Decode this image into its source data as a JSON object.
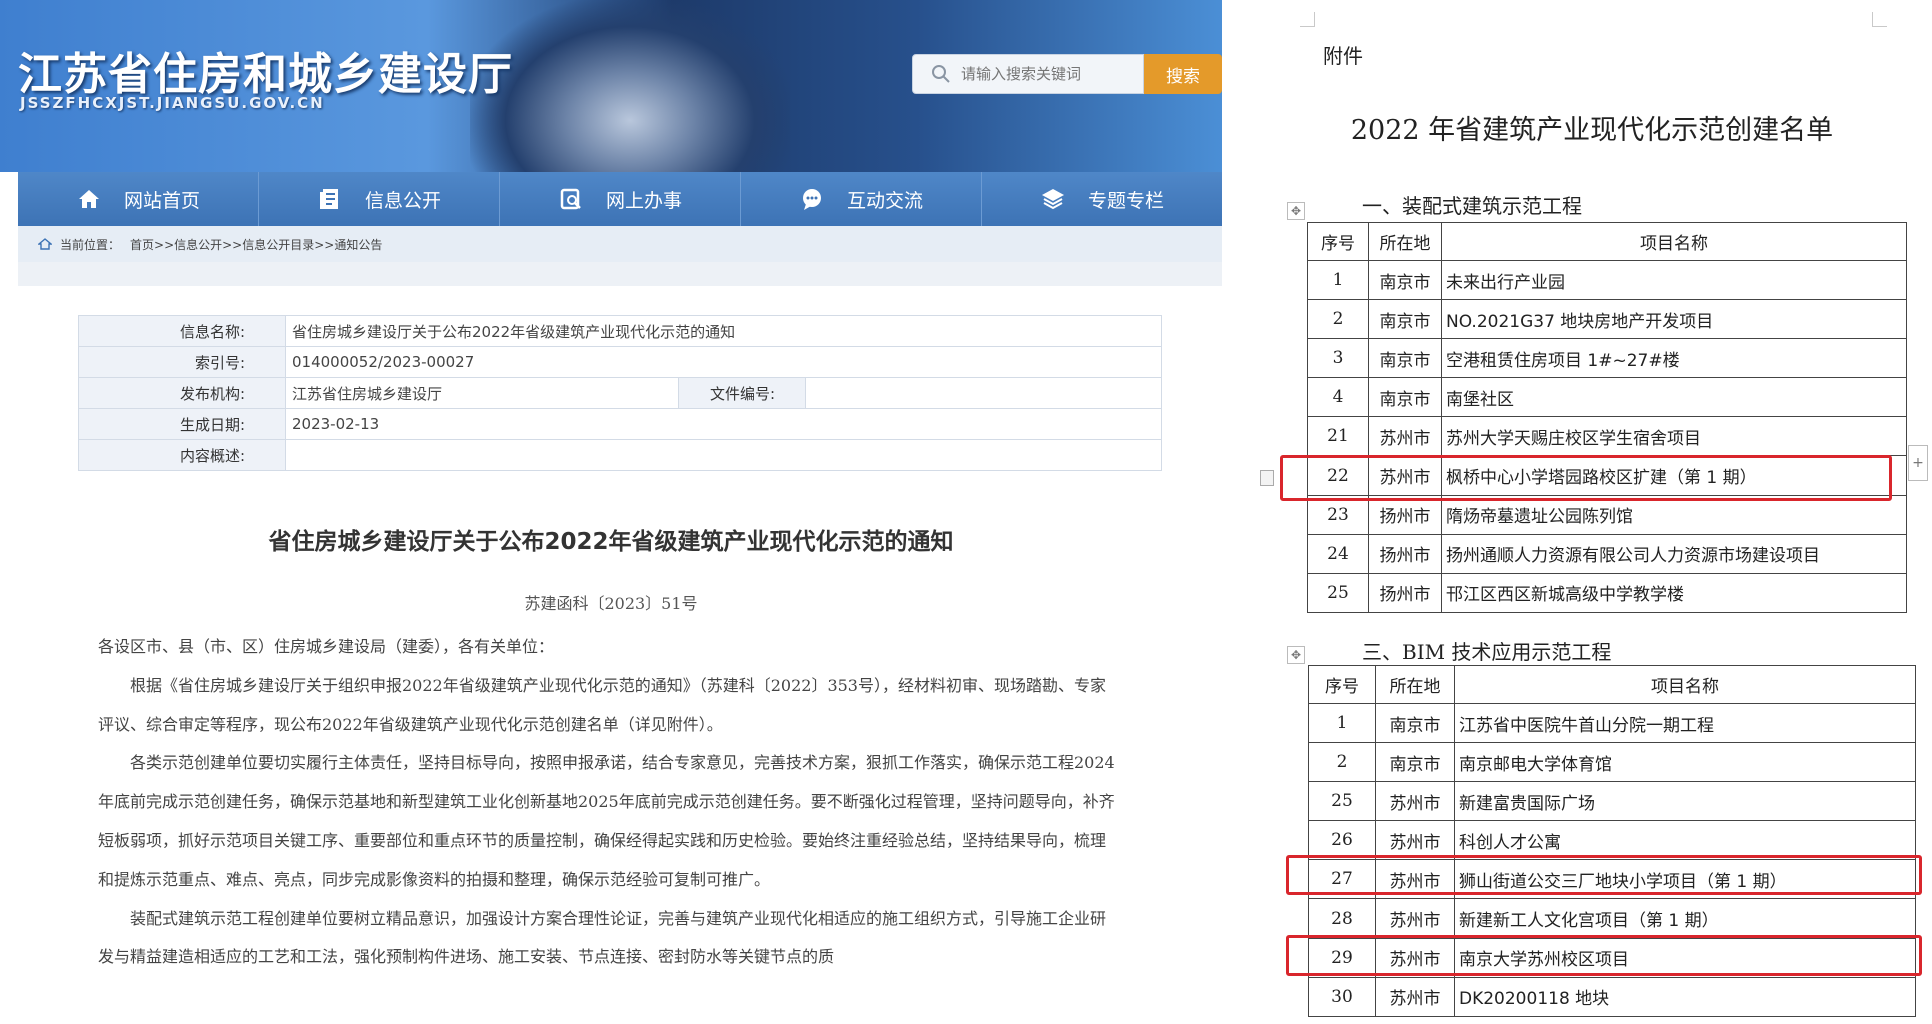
{
  "site": {
    "title": "江苏省住房和城乡建设厅",
    "domain": "JSSZFHCXJST.JIANGSU.GOV.CN",
    "search_placeholder": "请输入搜索关键词",
    "search_button": "搜索"
  },
  "nav": [
    {
      "label": "网站首页",
      "icon": "home-icon"
    },
    {
      "label": "信息公开",
      "icon": "document-icon"
    },
    {
      "label": "网上办事",
      "icon": "service-icon"
    },
    {
      "label": "互动交流",
      "icon": "chat-icon"
    },
    {
      "label": "专题专栏",
      "icon": "layers-icon"
    }
  ],
  "breadcrumb": {
    "label": "当前位置：",
    "path": "首页>>信息公开>>信息公开目录>>通知公告"
  },
  "info": {
    "name_label": "信息名称:",
    "name_value": "省住房城乡建设厅关于公布2022年省级建筑产业现代化示范的通知",
    "index_label": "索引号:",
    "index_value": "014000052/2023-00027",
    "org_label": "发布机构:",
    "org_value": "江苏省住房城乡建设厅",
    "fileno_label": "文件编号:",
    "fileno_value": "",
    "date_label": "生成日期:",
    "date_value": "2023-02-13",
    "summary_label": "内容概述:",
    "summary_value": ""
  },
  "notice": {
    "title": "省住房城乡建设厅关于公布2022年省级建筑产业现代化示范的通知",
    "doc_no": "苏建函科〔2023〕51号",
    "salutation": "各设区市、县（市、区）住房城乡建设局（建委），各有关单位：",
    "para1": "根据《省住房城乡建设厅关于组织申报2022年省级建筑产业现代化示范的通知》（苏建科〔2022〕353号），经材料初审、现场踏勘、专家评议、综合审定等程序，现公布2022年省级建筑产业现代化示范创建名单（详见附件）。",
    "para2": "各类示范创建单位要切实履行主体责任，坚持目标导向，按照申报承诺，结合专家意见，完善技术方案，狠抓工作落实，确保示范工程2024年底前完成示范创建任务，确保示范基地和新型建筑工业化创新基地2025年底前完成示范创建任务。要不断强化过程管理，坚持问题导向，补齐短板弱项，抓好示范项目关键工序、重要部位和重点环节的质量控制，确保经得起实践和历史检验。要始终注重经验总结，坚持结果导向，梳理和提炼示范重点、难点、亮点，同步完成影像资料的拍摄和整理，确保示范经验可复制可推广。",
    "para3": "装配式建筑示范工程创建单位要树立精品意识，加强设计方案合理性论证，完善与建筑产业现代化相适应的施工组织方式，引导施工企业研发与精益建造相适应的工艺和工法，强化预制构件进场、施工安装、节点连接、密封防水等关键节点的质"
  },
  "attachment": {
    "label": "附件",
    "title": "2022 年省建筑产业现代化示范创建名单",
    "section1": {
      "title": "一、装配式建筑示范工程",
      "headers": [
        "序号",
        "所在地",
        "项目名称"
      ],
      "rows": [
        [
          "1",
          "南京市",
          "未来出行产业园"
        ],
        [
          "2",
          "南京市",
          "NO.2021G37 地块房地产开发项目"
        ],
        [
          "3",
          "南京市",
          "空港租赁住房项目 1#~27#楼"
        ],
        [
          "4",
          "南京市",
          "南堡社区"
        ],
        [
          "21",
          "苏州市",
          "苏州大学天赐庄校区学生宿舍项目"
        ],
        [
          "22",
          "苏州市",
          "枫桥中心小学塔园路校区扩建（第 1 期）"
        ],
        [
          "23",
          "扬州市",
          "隋炀帝墓遗址公园陈列馆"
        ],
        [
          "24",
          "扬州市",
          "扬州通顺人力资源有限公司人力资源市场建设项目"
        ],
        [
          "25",
          "扬州市",
          "邗江区西区新城高级中学教学楼"
        ]
      ]
    },
    "section3": {
      "title": "三、BIM 技术应用示范工程",
      "headers": [
        "序号",
        "所在地",
        "项目名称"
      ],
      "rows": [
        [
          "1",
          "南京市",
          "江苏省中医院牛首山分院一期工程"
        ],
        [
          "2",
          "南京市",
          "南京邮电大学体育馆"
        ],
        [
          "25",
          "苏州市",
          "新建富贵国际广场"
        ],
        [
          "26",
          "苏州市",
          "科创人才公寓"
        ],
        [
          "27",
          "苏州市",
          "狮山街道公交三厂地块小学项目（第 1 期）"
        ],
        [
          "28",
          "苏州市",
          "新建新工人文化宫项目（第 1 期）"
        ],
        [
          "29",
          "苏州市",
          "南京大学苏州校区项目"
        ],
        [
          "30",
          "苏州市",
          "DK20200118 地块"
        ]
      ]
    },
    "highlight_color": "#d9262c"
  }
}
